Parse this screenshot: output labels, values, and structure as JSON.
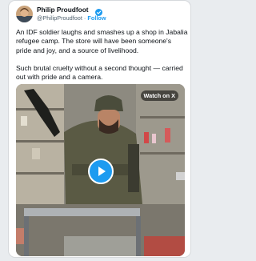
{
  "tweet": {
    "author_name": "Philip Proudfoot",
    "handle": "@PhilipProudfoot",
    "separator": " · ",
    "follow_label": "Follow",
    "paragraphs": [
      "An IDF soldier laughs and smashes up a shop in Jabalia refugee camp. The store will have been someone's pride and joy, and a source of livelihood.",
      "Such brutal cruelty without a second thought — carried out with pride and a camera."
    ]
  },
  "media": {
    "watch_label": "Watch on X",
    "play_icon": "play-icon"
  },
  "colors": {
    "accent": "#1d9bf0",
    "text": "#0f1419",
    "muted": "#536471"
  }
}
